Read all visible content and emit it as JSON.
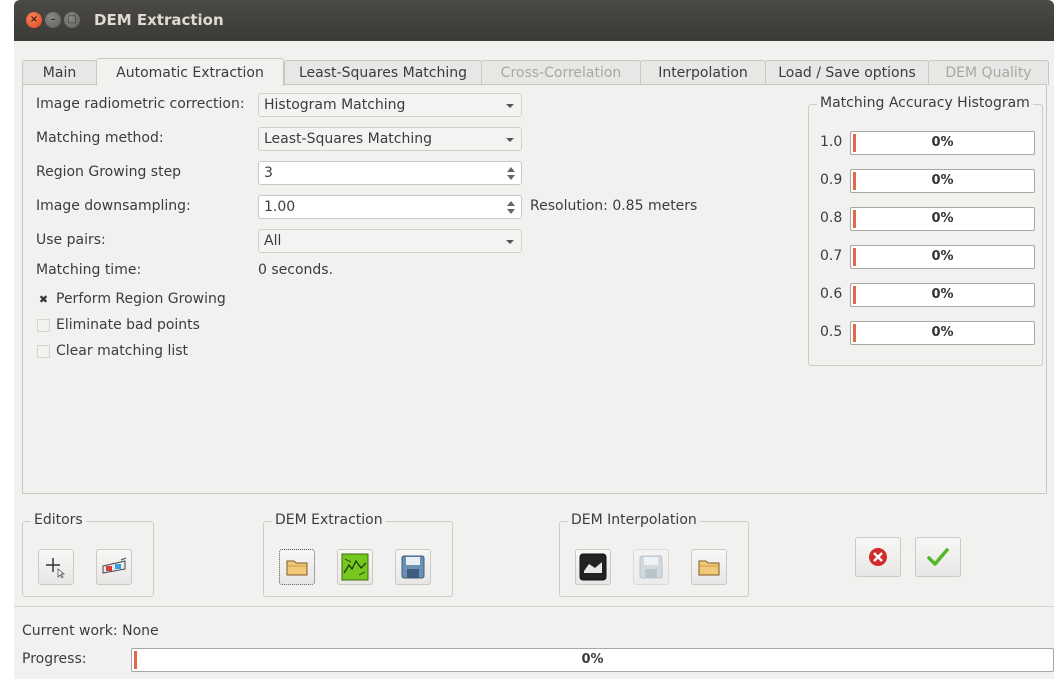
{
  "window": {
    "title": "DEM Extraction"
  },
  "tabs": [
    {
      "label": "Main",
      "state": "normal"
    },
    {
      "label": "Automatic Extraction",
      "state": "active"
    },
    {
      "label": "Least-Squares Matching",
      "state": "normal"
    },
    {
      "label": "Cross-Correlation",
      "state": "disabled"
    },
    {
      "label": "Interpolation",
      "state": "normal"
    },
    {
      "label": "Load / Save options",
      "state": "normal"
    },
    {
      "label": "DEM Quality",
      "state": "disabled"
    }
  ],
  "form": {
    "radiometric_label": "Image radiometric correction:",
    "radiometric_value": "Histogram Matching",
    "method_label": "Matching method:",
    "method_value": "Least-Squares Matching",
    "step_label": "Region Growing step",
    "step_value": "3",
    "downsampling_label": "Image downsampling:",
    "downsampling_value": "1.00",
    "resolution_text": "Resolution: 0.85 meters",
    "pairs_label": "Use pairs:",
    "pairs_value": "All",
    "time_label": "Matching time:",
    "time_value": "0 seconds."
  },
  "checkboxes": [
    {
      "label": "Perform Region Growing",
      "checked": true
    },
    {
      "label": "Eliminate bad points",
      "checked": false
    },
    {
      "label": "Clear matching list",
      "checked": false
    }
  ],
  "histogram": {
    "title": "Matching Accuracy Histogram",
    "rows": [
      {
        "label": "1.0",
        "value": "0%",
        "fraction": 0
      },
      {
        "label": "0.9",
        "value": "0%",
        "fraction": 0
      },
      {
        "label": "0.8",
        "value": "0%",
        "fraction": 0
      },
      {
        "label": "0.7",
        "value": "0%",
        "fraction": 0
      },
      {
        "label": "0.6",
        "value": "0%",
        "fraction": 0
      },
      {
        "label": "0.5",
        "value": "0%",
        "fraction": 0
      }
    ]
  },
  "groups": {
    "editors": "Editors",
    "dem_extraction": "DEM Extraction",
    "dem_interpolation": "DEM Interpolation"
  },
  "icons": {
    "editors": [
      "add-point-icon",
      "stereo-glasses-icon"
    ],
    "dem_extraction": [
      "open-folder-icon",
      "extract-terrain-icon",
      "save-floppy-icon"
    ],
    "dem_interpolation": [
      "interpolate-terrain-icon",
      "save-floppy-disabled-icon",
      "open-folder-icon"
    ],
    "dialog": [
      "cancel-icon",
      "ok-icon"
    ]
  },
  "status": {
    "current_work_label": "Current work:",
    "current_work_value": "None",
    "progress_label": "Progress:",
    "progress_value": "0%",
    "progress_fraction": 0
  },
  "colors": {
    "progress_fill": "#e2684a",
    "cancel_red": "#d12b2b",
    "ok_green": "#4fb82b",
    "titlebar": "#3b3a36"
  }
}
